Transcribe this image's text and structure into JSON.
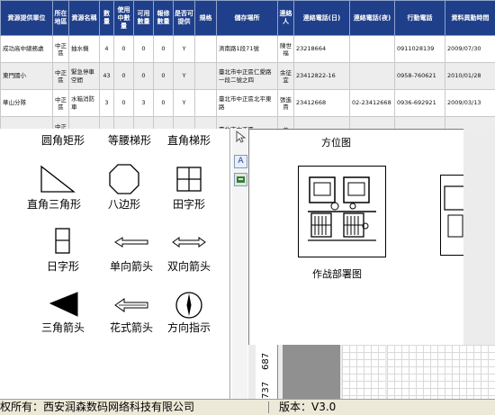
{
  "table": {
    "headers": [
      "資源提供單位",
      "所在地區",
      "資源名稱",
      "數量",
      "使用中數量",
      "可用數量",
      "報修數量",
      "是否可提供",
      "規格",
      "儲存場所",
      "連絡人",
      "連絡電話(日)",
      "連絡電話(夜)",
      "行動電話",
      "資料異動時間"
    ],
    "rows": [
      [
        "成功高中總務處",
        "中正區",
        "抽水機",
        "4",
        "0",
        "0",
        "0",
        "Y",
        "",
        "濟南路1段71號",
        "陳世福",
        "23218664",
        "",
        "0911028139",
        "2009/07/30"
      ],
      [
        "東門國小",
        "中正區",
        "緊急停車空間",
        "43",
        "0",
        "0",
        "0",
        "Y",
        "",
        "臺北市中正區仁愛路一段二號之四",
        "余征宜",
        "23412822-16",
        "",
        "0958-760621",
        "2010/01/28"
      ],
      [
        "華山分隊",
        "中正區",
        "水箱消防車",
        "3",
        "0",
        "3",
        "0",
        "Y",
        "",
        "臺北市中正區北平東路",
        "張進貴",
        "23412668",
        "02-23412668",
        "0936-692921",
        "2009/03/13"
      ],
      [
        "",
        "中正區",
        "",
        "",
        "",
        "",
        "",
        "",
        "",
        "臺北市中正區",
        "黃",
        "",
        "",
        "",
        ""
      ]
    ]
  },
  "palette": {
    "top_labels": [
      "圆角矩形",
      "等腰梯形",
      "直角梯形"
    ],
    "shapes": [
      {
        "label": "直角三角形",
        "icon": "right-triangle-icon"
      },
      {
        "label": "八边形",
        "icon": "octagon-icon"
      },
      {
        "label": "田字形",
        "icon": "tian-grid-icon"
      },
      {
        "label": "日字形",
        "icon": "ri-grid-icon"
      },
      {
        "label": "单向箭头",
        "icon": "single-arrow-icon"
      },
      {
        "label": "双向箭头",
        "icon": "double-arrow-icon"
      },
      {
        "label": "三角箭头",
        "icon": "triangle-arrow-icon"
      },
      {
        "label": "花式箭头",
        "icon": "fancy-arrow-icon"
      },
      {
        "label": "方向指示",
        "icon": "compass-icon"
      }
    ]
  },
  "toolbar": {
    "text_tool": "A"
  },
  "canvas": {
    "title": "方位图",
    "card_label": "作战部署图"
  },
  "ruler": {
    "marks": [
      "687",
      "737"
    ]
  },
  "status": {
    "copyright": "权所有：西安润森数码网络科技有限公司",
    "version": "版本：V3.0"
  }
}
